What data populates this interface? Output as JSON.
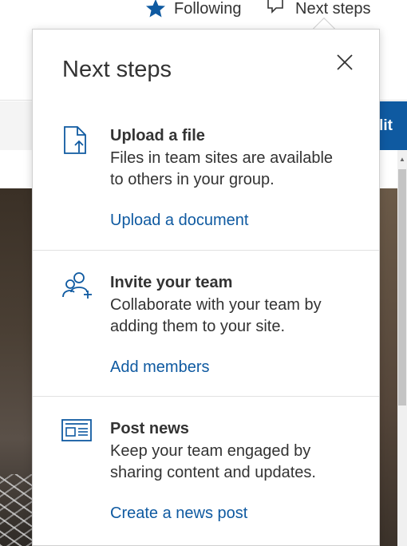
{
  "header": {
    "following_label": "Following",
    "next_steps_label": "Next steps"
  },
  "command_bar": {
    "edit_label_partial": "lit"
  },
  "panel": {
    "title": "Next steps",
    "close_icon": "close-icon",
    "steps": [
      {
        "icon": "upload-file-icon",
        "title": "Upload a file",
        "description": "Files in team sites are available to others in your group.",
        "link": "Upload a document"
      },
      {
        "icon": "invite-people-icon",
        "title": "Invite your team",
        "description": "Collaborate with your team by adding them to your site.",
        "link": "Add members"
      },
      {
        "icon": "news-icon",
        "title": "Post news",
        "description": "Keep your team engaged by sharing content and updates.",
        "link": "Create a news post"
      }
    ]
  },
  "colors": {
    "accent": "#0f5aa1",
    "text": "#333333",
    "divider": "#e1e1e1"
  }
}
